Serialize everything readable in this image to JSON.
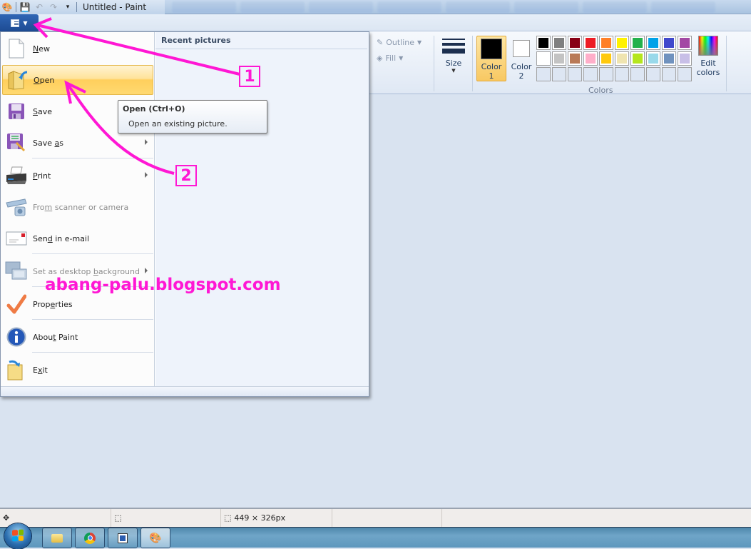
{
  "window": {
    "title": "Untitled - Paint",
    "quick_access": [
      "paint-icon",
      "save-icon",
      "undo-icon",
      "redo-icon",
      "customize-qat-icon"
    ]
  },
  "ribbon": {
    "outline_label": "Outline",
    "fill_label": "Fill",
    "size_label": "Size",
    "color1_label_line1": "Color",
    "color1_label_line2": "1",
    "color2_label_line1": "Color",
    "color2_label_line2": "2",
    "color1_value": "#000000",
    "color2_value": "#ffffff",
    "colors_group_label": "Colors",
    "edit_colors_line1": "Edit",
    "edit_colors_line2": "colors",
    "palette": [
      "#000000",
      "#7f7f7f",
      "#880015",
      "#ed1c24",
      "#ff7f27",
      "#fff200",
      "#22b14c",
      "#00a2e8",
      "#3f48cc",
      "#a349a4",
      "#ffffff",
      "#c3c3c3",
      "#b97a57",
      "#ffaec9",
      "#ffc90e",
      "#efe4b0",
      "#b5e61d",
      "#99d9ea",
      "#7092be",
      "#c8bfe7"
    ],
    "palette_empty_slots": 10
  },
  "app_menu": {
    "recent_header": "Recent pictures",
    "items": [
      {
        "pre": "",
        "u": "N",
        "post": "ew",
        "icon": "new-document-icon",
        "disabled": false,
        "submenu": false
      },
      {
        "pre": "",
        "u": "O",
        "post": "pen",
        "icon": "open-folder-icon",
        "disabled": false,
        "submenu": false,
        "highlighted": true
      },
      {
        "pre": "",
        "u": "S",
        "post": "ave",
        "icon": "save-floppy-icon",
        "disabled": false,
        "submenu": false
      },
      {
        "pre": "Save ",
        "u": "a",
        "post": "s",
        "icon": "save-as-icon",
        "disabled": false,
        "submenu": true
      },
      {
        "pre": "",
        "u": "P",
        "post": "rint",
        "icon": "printer-icon",
        "disabled": false,
        "submenu": true
      },
      {
        "pre": "Fro",
        "u": "m",
        "post": " scanner or camera",
        "icon": "scanner-camera-icon",
        "disabled": true,
        "submenu": false
      },
      {
        "pre": "Sen",
        "u": "d",
        "post": " in e-mail",
        "icon": "email-icon",
        "disabled": false,
        "submenu": false
      },
      {
        "pre": "Set as desktop ",
        "u": "b",
        "post": "ackground",
        "icon": "desktop-background-icon",
        "disabled": true,
        "submenu": true
      },
      {
        "pre": "Prop",
        "u": "e",
        "post": "rties",
        "icon": "properties-check-icon",
        "disabled": false,
        "submenu": false
      },
      {
        "pre": "Abou",
        "u": "t",
        "post": " Paint",
        "icon": "about-info-icon",
        "disabled": false,
        "submenu": false
      },
      {
        "pre": "E",
        "u": "x",
        "post": "it",
        "icon": "exit-icon",
        "disabled": false,
        "submenu": false
      }
    ]
  },
  "tooltip": {
    "title": "Open (Ctrl+O)",
    "description": "Open an existing picture."
  },
  "statusbar": {
    "selection_size": "",
    "canvas_size": "449 × 326px"
  },
  "taskbar": {
    "items": [
      "windows-explorer",
      "google-chrome",
      "image-editor",
      "paint"
    ]
  },
  "annotations": {
    "step1": "1",
    "step2": "2",
    "watermark": "abang-palu.blogspot.com",
    "color": "#ff17d4"
  }
}
